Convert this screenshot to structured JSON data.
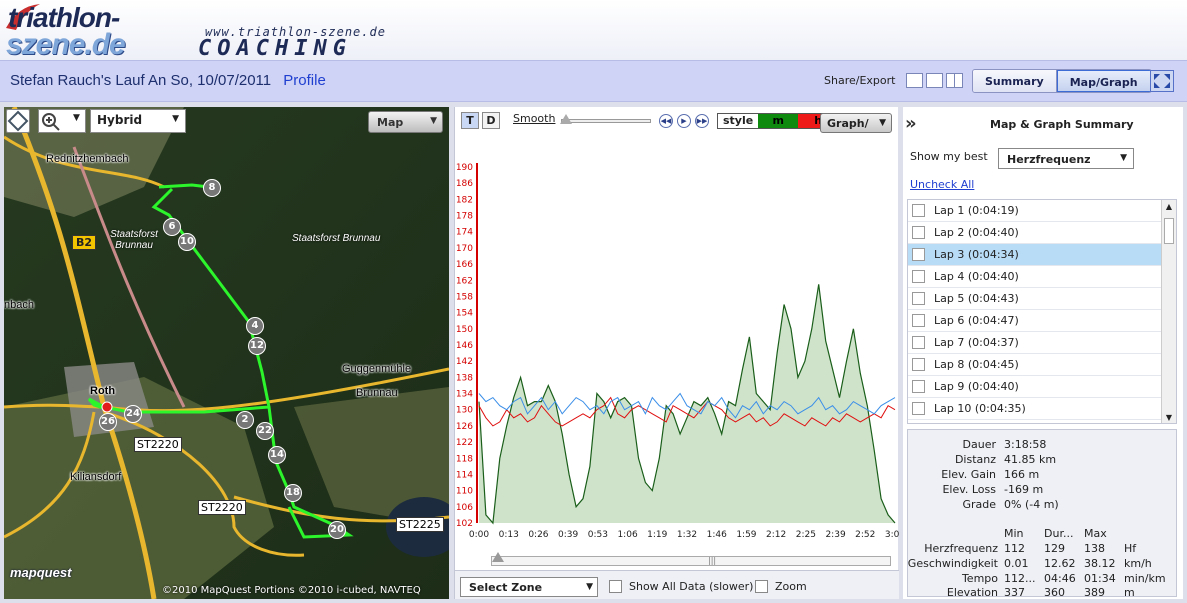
{
  "header": {
    "logo_line1": "triathlon-",
    "logo_line2": "szene.de",
    "logo_url": "www.triathlon-szene.de",
    "logo_coaching": "COACHING"
  },
  "titlebar": {
    "title": "Stefan Rauch's Lauf An So, 10/07/2011",
    "profile_link": "Profile",
    "share": "Share/Export",
    "tabs": [
      {
        "label": "Summary"
      },
      {
        "label": "Map/Graph"
      }
    ]
  },
  "map": {
    "type_label": "Hybrid",
    "map_button": "Map",
    "places": [
      "Rednitzhembach",
      "Staatsforst Brunnau",
      "Staatsforst Brunnau",
      "nbach",
      "Guggenmühle",
      "Brunnau",
      "Roth",
      "Kiliansdorf"
    ],
    "road_tags": [
      "B2",
      "ST2220",
      "ST2220",
      "ST2225"
    ],
    "markers": [
      "8",
      "6",
      "10",
      "4",
      "12",
      "2",
      "22",
      "14",
      "18",
      "20",
      "24",
      "26"
    ],
    "brand": "mapquest",
    "copyright": "©2010 MapQuest   Portions ©2010 i-cubed, NAVTEQ"
  },
  "graph_toolbar": {
    "t_label": "T",
    "d_label": "D",
    "smooth_label": "Smooth",
    "style_label": "style",
    "style_m": "m",
    "style_h": "h",
    "graph_button": "Graph/"
  },
  "chart_data": {
    "type": "line",
    "y_ticks": [
      102,
      106,
      110,
      114,
      118,
      122,
      126,
      130,
      134,
      138,
      142,
      146,
      150,
      154,
      158,
      162,
      166,
      170,
      174,
      178,
      182,
      186,
      190
    ],
    "x_ticks": [
      "0:00",
      "0:13",
      "0:26",
      "0:39",
      "0:53",
      "1:06",
      "1:19",
      "1:32",
      "1:46",
      "1:59",
      "2:12",
      "2:25",
      "2:39",
      "2:52",
      "3:05"
    ],
    "ylim": [
      102,
      190
    ],
    "series": [
      {
        "color": "#1a5e1a",
        "fill": "#cfe3cb",
        "values": [
          132,
          104,
          102,
          118,
          126,
          133,
          138,
          131,
          132,
          132,
          136,
          132,
          124,
          114,
          106,
          108,
          116,
          134,
          132,
          128,
          132,
          133,
          131,
          118,
          112,
          110,
          118,
          131,
          129,
          124,
          128,
          132,
          131,
          133,
          129,
          124,
          132,
          131,
          140,
          148,
          134,
          132,
          130,
          144,
          156,
          150,
          138,
          142,
          150,
          161,
          147,
          140,
          133,
          142,
          150,
          139,
          131,
          120,
          108,
          104,
          102
        ]
      },
      {
        "color": "#e01010",
        "values": [
          131,
          128,
          126,
          127,
          130,
          128,
          129,
          127,
          128,
          131,
          129,
          127,
          126,
          127,
          128,
          129,
          128,
          130,
          131,
          133,
          129,
          128,
          130,
          131,
          130,
          129,
          128,
          127,
          131,
          130,
          129,
          128,
          130,
          132,
          131,
          130,
          128,
          127,
          128,
          129,
          127,
          128,
          126,
          127,
          129,
          128,
          127,
          126,
          128,
          127,
          126,
          128,
          127,
          129,
          128,
          127,
          128,
          129,
          128,
          131,
          130
        ]
      },
      {
        "color": "#3a8ee8",
        "values": [
          134,
          132,
          133,
          131,
          130,
          132,
          133,
          129,
          131,
          133,
          130,
          132,
          129,
          131,
          133,
          132,
          130,
          131,
          129,
          132,
          133,
          130,
          131,
          132,
          129,
          133,
          131,
          130,
          132,
          134,
          131,
          130,
          129,
          132,
          131,
          133,
          130,
          128,
          131,
          130,
          132,
          129,
          131,
          130,
          132,
          131,
          129,
          130,
          131,
          133,
          130,
          131,
          129,
          130,
          132,
          131,
          130,
          129,
          131,
          132,
          133
        ]
      }
    ]
  },
  "graph_bottom": {
    "select_zone": "Select Zone",
    "show_all": "Show All Data (slower)",
    "zoom": "Zoom"
  },
  "side": {
    "title": "Map & Graph Summary",
    "best_label": "Show my best",
    "best_value": "Herzfrequenz",
    "uncheck_all": "Uncheck All",
    "laps": [
      {
        "label": "Lap 1 (0:04:19)"
      },
      {
        "label": "Lap 2 (0:04:40)"
      },
      {
        "label": "Lap 3 (0:04:34)"
      },
      {
        "label": "Lap 4 (0:04:40)"
      },
      {
        "label": "Lap 5 (0:04:43)"
      },
      {
        "label": "Lap 6 (0:04:47)"
      },
      {
        "label": "Lap 7 (0:04:37)"
      },
      {
        "label": "Lap 8 (0:04:45)"
      },
      {
        "label": "Lap 9 (0:04:40)"
      },
      {
        "label": "Lap 10 (0:04:35)"
      }
    ],
    "summary": [
      {
        "key": "Dauer",
        "value": "3:18:58"
      },
      {
        "key": "Distanz",
        "value": "41.85 km"
      },
      {
        "key": "Elev. Gain",
        "value": "166 m"
      },
      {
        "key": "Elev. Loss",
        "value": "-169 m"
      },
      {
        "key": "Grade",
        "value": "0% (-4 m)"
      }
    ],
    "table_headers": [
      "Min",
      "Dur...",
      "Max"
    ],
    "table_rows": [
      {
        "name": "Herzfrequenz",
        "min": "112",
        "avg": "129",
        "max": "138",
        "unit": "Hf"
      },
      {
        "name": "Geschwindigkeit",
        "min": "0.01",
        "avg": "12.62",
        "max": "38.12",
        "unit": "km/h"
      },
      {
        "name": "Tempo",
        "min": "112...",
        "avg": "04:46",
        "max": "01:34",
        "unit": "min/km"
      },
      {
        "name": "Elevation",
        "min": "337",
        "avg": "360",
        "max": "389",
        "unit": "m"
      }
    ]
  }
}
